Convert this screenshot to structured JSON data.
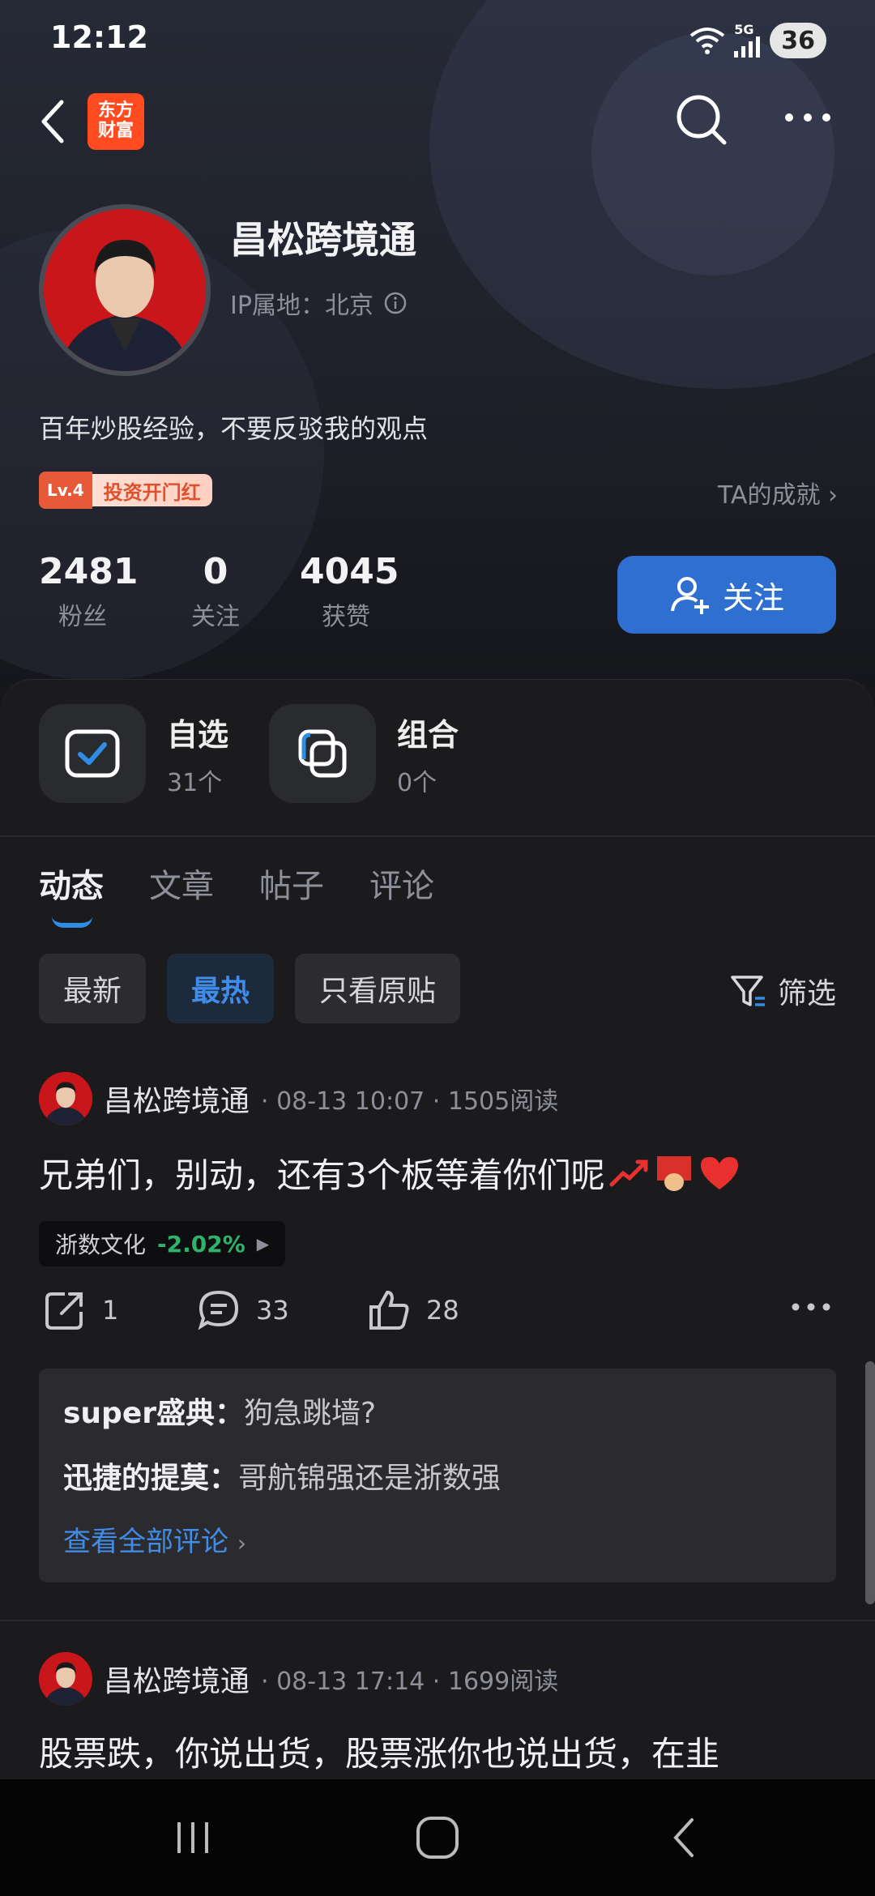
{
  "status_bar": {
    "time": "12:12",
    "network": "5G",
    "battery": "36"
  },
  "topnav": {
    "logo_text": "东方\n财富"
  },
  "profile": {
    "name": "昌松跨境通",
    "ip_location": "IP属地：北京",
    "bio": "百年炒股经验，不要反驳我的观点",
    "level": "Lv.4",
    "level_title": "投资开门红",
    "achievements": "TA的成就"
  },
  "stats": [
    {
      "value": "2481",
      "label": "粉丝"
    },
    {
      "value": "0",
      "label": "关注"
    },
    {
      "value": "4045",
      "label": "获赞"
    }
  ],
  "follow_button": "关注",
  "portfolio": [
    {
      "title": "自选",
      "count": "31个"
    },
    {
      "title": "组合",
      "count": "0个"
    }
  ],
  "tabs": [
    "动态",
    "文章",
    "帖子",
    "评论"
  ],
  "filters": [
    "最新",
    "最热",
    "只看原贴"
  ],
  "filter_button": "筛选",
  "posts": [
    {
      "author": "昌松跨境通",
      "meta": "· 08-13 10:07 · 1505阅读",
      "text": "兄弟们，别动，还有3个板等着你们呢",
      "stock_name": "浙数文化",
      "stock_change": "-2.02%",
      "shares": "1",
      "comments_count": "33",
      "likes": "28",
      "comments": [
        {
          "user": "super盛典：",
          "text": "狗急跳墙?"
        },
        {
          "user": "迅捷的提莫：",
          "text": "哥航锦强还是浙数强"
        }
      ],
      "view_all": "查看全部评论"
    },
    {
      "author": "昌松跨境通",
      "meta": "· 08-13 17:14 · 1699阅读",
      "text": "股票跌，你说出货，股票涨你也说出货，在韭"
    }
  ]
}
